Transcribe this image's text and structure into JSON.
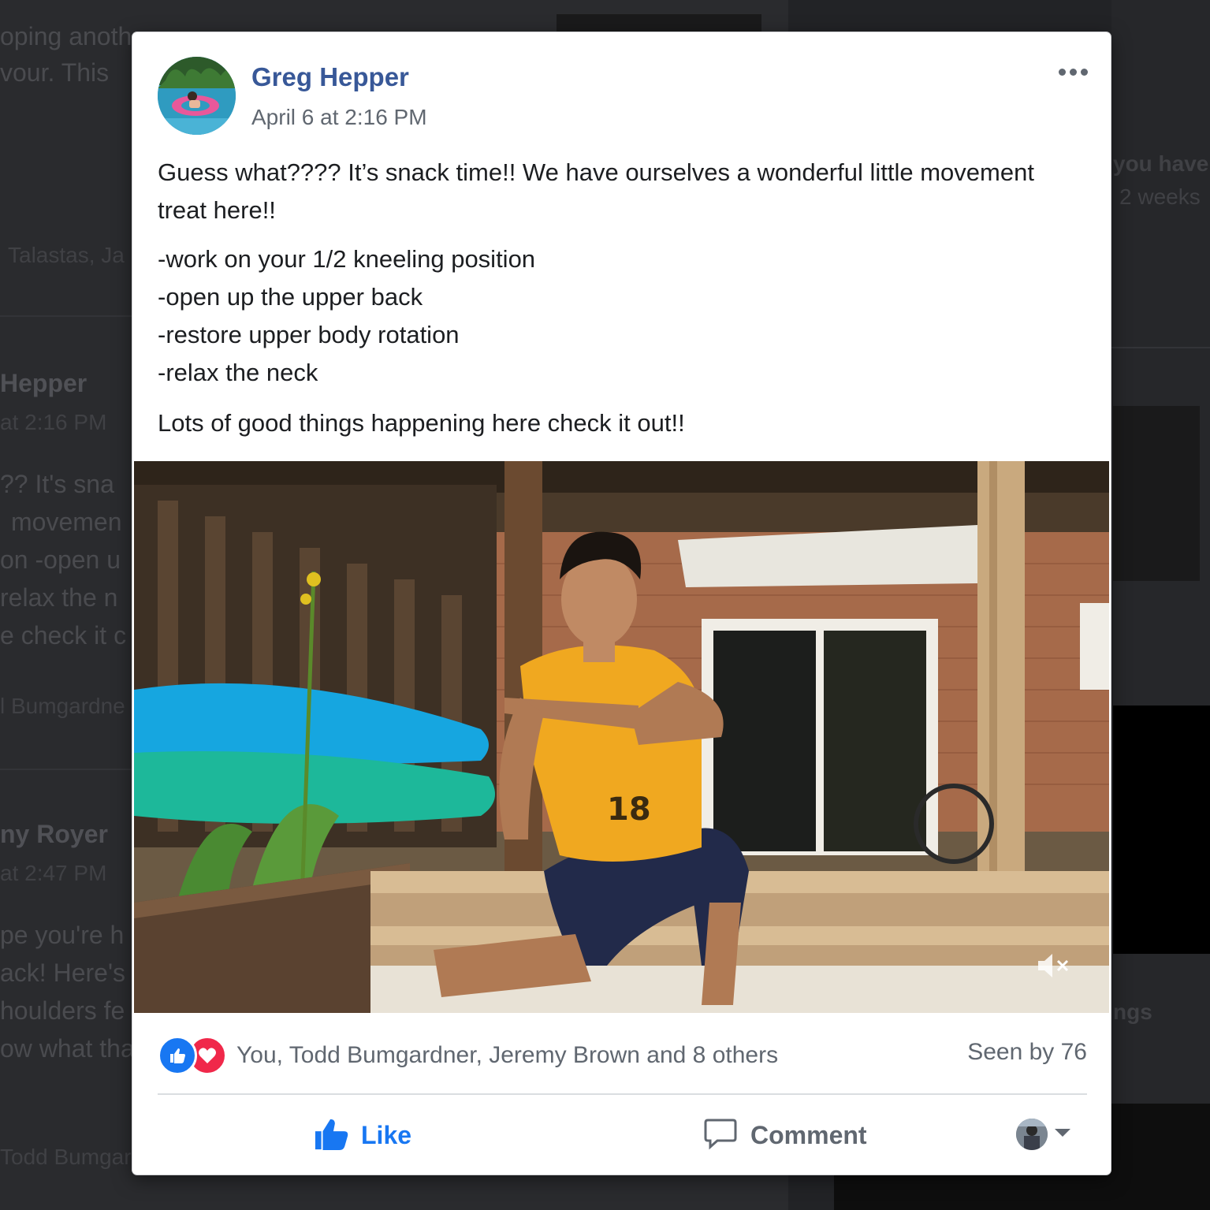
{
  "background_feed": {
    "fragments": [
      "oping anoth",
      "vour. This",
      "Talastas, Ja",
      "Hepper",
      "at 2:16 PM",
      "?? It's sna",
      "movemen",
      "on -open u",
      "relax the n",
      "e check it c",
      "l Bumgardne",
      "ny Royer",
      "at 2:47 PM",
      "pe you're h",
      "ack! Here's",
      "houlders fe",
      "ow what tha",
      "Todd Bumgar",
      "you have",
      "2 weeks",
      "ngs"
    ]
  },
  "post": {
    "author": "Greg Hepper",
    "timestamp": "April 6 at 2:16 PM",
    "intro": "Guess what???? It’s snack time!! We have ourselves a wonderful little movement treat here!!",
    "bullets": [
      "-work on your 1/2 kneeling position",
      "-open up the upper back",
      "-restore upper body rotation",
      "-relax the neck"
    ],
    "closing": "Lots of good things happening here check it out!!",
    "reactions_text": "You, Todd Bumgardner, Jeremy Brown and 8 others",
    "seen_by": "Seen by 76",
    "actions": {
      "like": "Like",
      "comment": "Comment"
    }
  },
  "colors": {
    "link_blue": "#385898",
    "like_blue": "#1877f2",
    "love_red": "#f0284a",
    "secondary_text": "#606770"
  },
  "icons": [
    "more-options-icon",
    "thumbs-up-icon",
    "heart-icon",
    "like-icon",
    "comment-icon",
    "chevron-down-icon",
    "mute-icon"
  ]
}
